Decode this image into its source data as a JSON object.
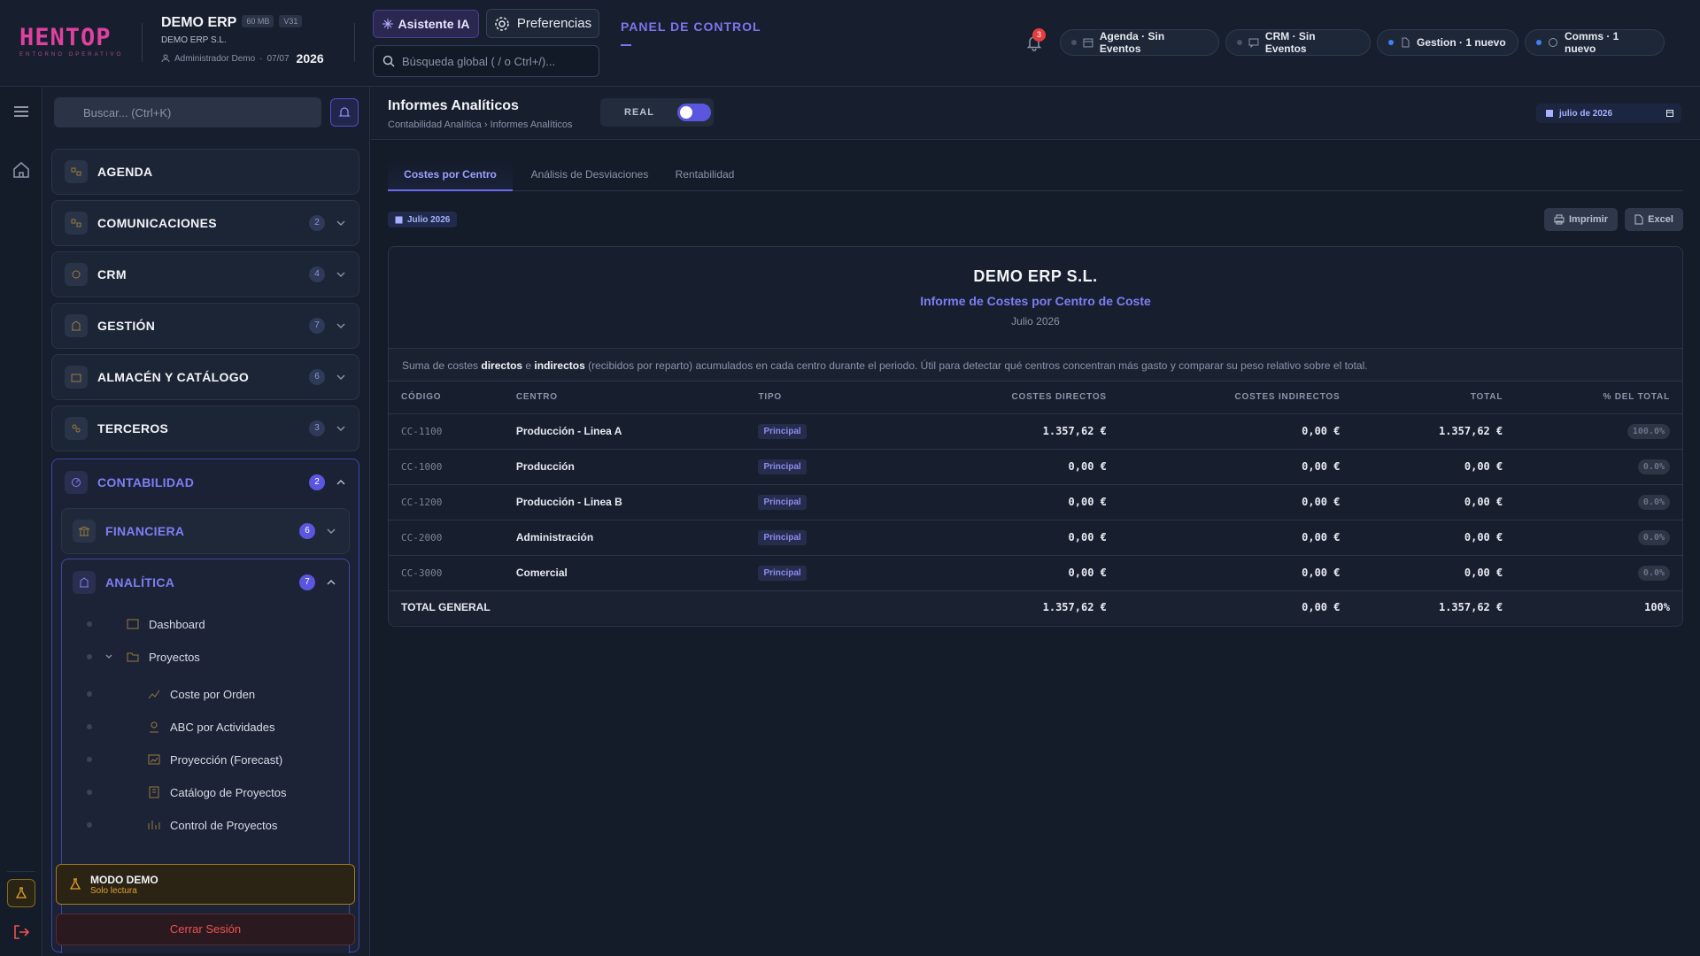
{
  "header": {
    "logo": "HENTOP",
    "logo_sub": "ENTORNO OPERATIVO",
    "company": "DEMO ERP",
    "chip_size": "60 MB",
    "chip_version": "V31",
    "company_legal": "DEMO ERP S.L.",
    "user": "Administrador Demo",
    "sep": "·",
    "date": "07/07",
    "year": "2026",
    "ai_button": "Asistente IA",
    "prefs_button": "Preferencias",
    "search_placeholder": "Búsqueda global ( / o Ctrl+/)...",
    "panel": "PANEL DE CONTROL",
    "notifications": "3",
    "status_pills": [
      {
        "label": "Agenda · Sin Eventos",
        "active": false
      },
      {
        "label": "CRM · Sin Eventos",
        "active": false
      },
      {
        "label": "Gestion · 1 nuevo",
        "active": true
      },
      {
        "label": "Comms · 1 nuevo",
        "active": true
      }
    ]
  },
  "sidebar": {
    "search_placeholder": "Buscar... (Ctrl+K)",
    "items": [
      {
        "label": "AGENDA",
        "badge": ""
      },
      {
        "label": "COMUNICACIONES",
        "badge": "2"
      },
      {
        "label": "CRM",
        "badge": "4"
      },
      {
        "label": "GESTIÓN",
        "badge": "7"
      },
      {
        "label": "ALMACÉN Y CATÁLOGO",
        "badge": "6"
      },
      {
        "label": "TERCEROS",
        "badge": "3"
      }
    ],
    "contabilidad": {
      "label": "CONTABILIDAD",
      "badge": "2"
    },
    "financiera": {
      "label": "FINANCIERA",
      "badge": "6"
    },
    "analitica": {
      "label": "ANALÍTICA",
      "badge": "7"
    },
    "tree": [
      {
        "label": "Dashboard"
      },
      {
        "label": "Proyectos"
      },
      {
        "label": "Coste por Orden"
      },
      {
        "label": "ABC por Actividades"
      },
      {
        "label": "Proyección (Forecast)"
      },
      {
        "label": "Catálogo de Proyectos"
      },
      {
        "label": "Control de Proyectos"
      }
    ],
    "demo_title": "MODO DEMO",
    "demo_sub": "Solo lectura",
    "logout": "Cerrar Sesión"
  },
  "page": {
    "title": "Informes Analíticos",
    "breadcrumb_parent": "Contabilidad Analítica",
    "breadcrumb_current": "Informes Analíticos",
    "mode_label": "REAL",
    "mode_on": true,
    "date_value": "julio de 2026",
    "tabs": [
      {
        "label": "Costes por Centro",
        "active": true
      },
      {
        "label": "Análisis de Desviaciones",
        "active": false
      },
      {
        "label": "Rentabilidad",
        "active": false
      }
    ],
    "period_badge": "Julio 2026",
    "print_button": "Imprimir",
    "excel_button": "Excel"
  },
  "report": {
    "company": "DEMO ERP S.L.",
    "title": "Informe de Costes por Centro de Coste",
    "period": "Julio 2026",
    "desc_1": "Suma de costes ",
    "desc_b1": "directos",
    "desc_2": " e ",
    "desc_b2": "indirectos",
    "desc_3": " (recibidos por reparto) acumulados en cada centro durante el periodo. Útil para detectar qué centros concentran más gasto y comparar su peso relativo sobre el total.",
    "columns": [
      "CÓDIGO",
      "CENTRO",
      "TIPO",
      "COSTES DIRECTOS",
      "COSTES INDIRECTOS",
      "TOTAL",
      "% DEL TOTAL"
    ],
    "rows": [
      [
        "CC-1100",
        "Producción - Linea A",
        "Principal",
        "1.357,62 €",
        "0,00 €",
        "1.357,62 €",
        "100.0%"
      ],
      [
        "CC-1000",
        "Producción",
        "Principal",
        "0,00 €",
        "0,00 €",
        "0,00 €",
        "0.0%"
      ],
      [
        "CC-1200",
        "Producción - Linea B",
        "Principal",
        "0,00 €",
        "0,00 €",
        "0,00 €",
        "0.0%"
      ],
      [
        "CC-2000",
        "Administración",
        "Principal",
        "0,00 €",
        "0,00 €",
        "0,00 €",
        "0.0%"
      ],
      [
        "CC-3000",
        "Comercial",
        "Principal",
        "0,00 €",
        "0,00 €",
        "0,00 €",
        "0.0%"
      ]
    ],
    "total": [
      "TOTAL GENERAL",
      "1.357,62 €",
      "0,00 €",
      "1.357,62 €",
      "100%"
    ]
  },
  "colors": {
    "accent": "#7e7ef5",
    "danger": "#f05050",
    "warning": "#e0a030",
    "brand": "#e040a0"
  }
}
